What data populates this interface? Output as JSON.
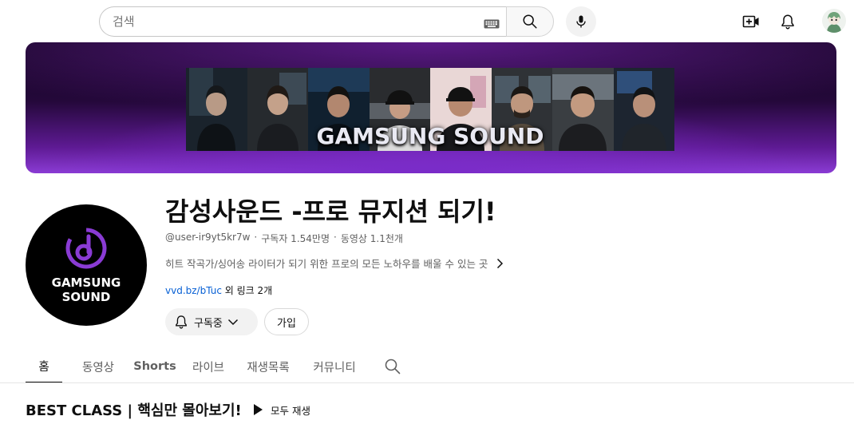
{
  "search": {
    "placeholder": "검색"
  },
  "banner": {
    "logo_text": "GAMSUNG SOUND",
    "portrait_count": 8
  },
  "channel": {
    "avatar_text_line1": "GAMSUNG",
    "avatar_text_line2": "SOUND",
    "title": "감성사운드 -프로 뮤지션 되기!",
    "handle": "@user-ir9yt5kr7w",
    "separator": "·",
    "subscribers": "구독자 1.54만명",
    "videos": "동영상 1.1천개",
    "description": "히트 작곡가/싱어송 라이터가 되기 위한 프로의 모든 노하우를 배울 수 있는 곳",
    "link": "vvd.bz/bTuc",
    "links_suffix": " 외 링크 2개",
    "subscribe_label": "구독중",
    "join_label": "가입"
  },
  "tabs": [
    {
      "label": "홈",
      "active": true
    },
    {
      "label": "동영상",
      "active": false
    },
    {
      "label": "Shorts",
      "active": false
    },
    {
      "label": "라이브",
      "active": false
    },
    {
      "label": "재생목록",
      "active": false
    },
    {
      "label": "커뮤니티",
      "active": false
    }
  ],
  "section": {
    "title": "BEST CLASS | 핵심만 몰아보기!",
    "play_all_label": "모두 재생"
  },
  "colors": {
    "accent_purple": "#8a3bd4",
    "link_blue": "#065fd4",
    "banner_dark": "#150622"
  }
}
